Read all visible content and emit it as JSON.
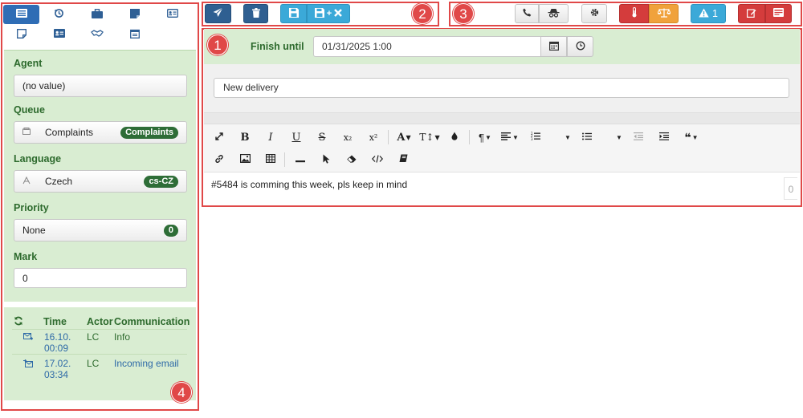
{
  "left_tabs": {
    "row1": [
      "list-icon",
      "history-icon",
      "briefcase-icon",
      "note-icon",
      "card-icon"
    ],
    "row2": [
      "sticky-note-icon",
      "contact-card-icon",
      "handshake-icon",
      "calendar-icon"
    ]
  },
  "properties": {
    "agent": {
      "label": "Agent",
      "value": "(no value)"
    },
    "queue": {
      "label": "Queue",
      "value": "Complaints",
      "badge": "Complaints"
    },
    "language": {
      "label": "Language",
      "value": "Czech",
      "badge": "cs-CZ"
    },
    "priority": {
      "label": "Priority",
      "value": "None",
      "badge": "0"
    },
    "mark": {
      "label": "Mark",
      "value": "0"
    }
  },
  "history": {
    "columns": {
      "time": "Time",
      "actor": "Actor",
      "communication": "Communication"
    },
    "rows": [
      {
        "time_line1": "16.10.",
        "time_line2": "00:09",
        "actor": "LC",
        "communication": "Info"
      },
      {
        "time_line1": "17.02.",
        "time_line2": "03:34",
        "actor": "LC",
        "communication": "Incoming email"
      }
    ]
  },
  "toolbar_right": {
    "alerts_count": "1"
  },
  "editor": {
    "finish_until_label": "Finish until",
    "finish_until_value": "01/31/2025 1:00",
    "subject": "New delivery",
    "body": "#5484 is comming this week, pls keep in mind",
    "char_count": "0",
    "format_superscript": "x²",
    "format_subscript": "x₂"
  },
  "callouts": [
    "1",
    "2",
    "3",
    "4"
  ],
  "colors": {
    "accent": "#2f6db5",
    "panel": "#d9edd2",
    "label": "#2d6a2d",
    "callout": "#e04848",
    "badge": "#2e6d37"
  }
}
